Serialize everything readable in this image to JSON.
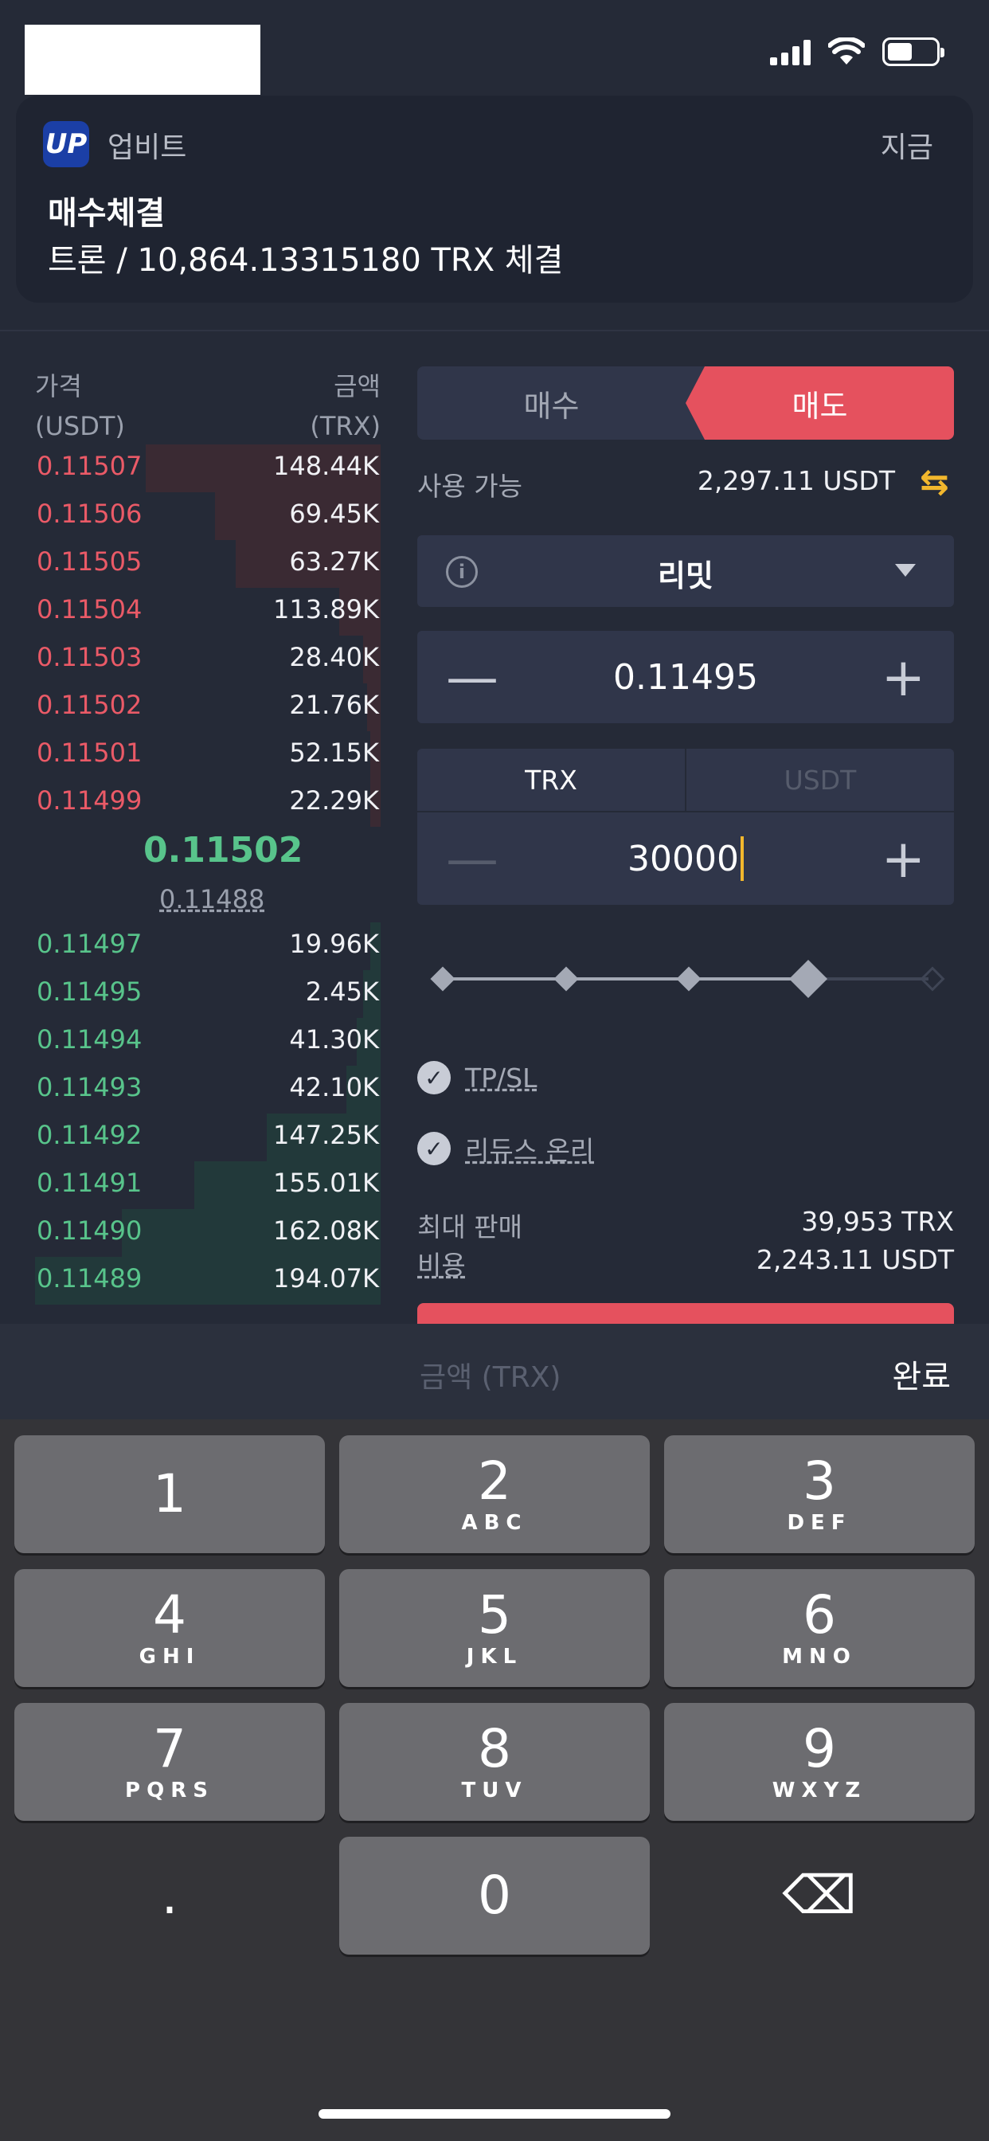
{
  "notification": {
    "app_logo": "UP",
    "app_name": "업비트",
    "time": "지금",
    "title": "매수체결",
    "body": "트론 / 10,864.13315180 TRX 체결"
  },
  "orderbook": {
    "price_header": "가격",
    "price_unit": "(USDT)",
    "amount_header": "금액",
    "amount_unit": "(TRX)",
    "asks": [
      {
        "price": "0.11507",
        "amount": "148.44K",
        "depth": 0.68
      },
      {
        "price": "0.11506",
        "amount": "69.45K",
        "depth": 0.48
      },
      {
        "price": "0.11505",
        "amount": "63.27K",
        "depth": 0.42
      },
      {
        "price": "0.11504",
        "amount": "113.89K",
        "depth": 0.12
      },
      {
        "price": "0.11503",
        "amount": "28.40K",
        "depth": 0.05
      },
      {
        "price": "0.11502",
        "amount": "21.76K",
        "depth": 0.04
      },
      {
        "price": "0.11501",
        "amount": "52.15K",
        "depth": 0.03
      },
      {
        "price": "0.11499",
        "amount": "22.29K",
        "depth": 0.03
      }
    ],
    "last_price": "0.11502",
    "mark_price": "0.11488",
    "bids": [
      {
        "price": "0.11497",
        "amount": "19.96K",
        "depth": 0.03
      },
      {
        "price": "0.11495",
        "amount": "2.45K",
        "depth": 0.05
      },
      {
        "price": "0.11494",
        "amount": "41.30K",
        "depth": 0.07
      },
      {
        "price": "0.11493",
        "amount": "42.10K",
        "depth": 0.1
      },
      {
        "price": "0.11492",
        "amount": "147.25K",
        "depth": 0.33
      },
      {
        "price": "0.11491",
        "amount": "155.01K",
        "depth": 0.54
      },
      {
        "price": "0.11490",
        "amount": "162.08K",
        "depth": 0.75
      },
      {
        "price": "0.11489",
        "amount": "194.07K",
        "depth": 1.0
      }
    ]
  },
  "order_form": {
    "buy_tab": "매수",
    "sell_tab": "매도",
    "available_label": "사용 가능",
    "available_value": "2,297.11 USDT",
    "swap_icon": "⇆",
    "order_type": "리밋",
    "price_value": "0.11495",
    "minus": "—",
    "plus": "+",
    "unit_tab_trx": "TRX",
    "unit_tab_usdt": "USDT",
    "quantity_value": "30000",
    "slider_level": 0.75,
    "tpsl_label": "TP/SL",
    "reduce_only_label": "리듀스 온리",
    "max_sell_label": "최대 판매",
    "max_sell_value": "39,953 TRX",
    "cost_label": "비용",
    "cost_value": "2,243.11 USDT"
  },
  "keyboard_bar": {
    "field_label": "금액 (TRX)",
    "done": "완료"
  },
  "keypad": {
    "keys": [
      {
        "num": "1",
        "sub": ""
      },
      {
        "num": "2",
        "sub": "ABC"
      },
      {
        "num": "3",
        "sub": "DEF"
      },
      {
        "num": "4",
        "sub": "GHI"
      },
      {
        "num": "5",
        "sub": "JKL"
      },
      {
        "num": "6",
        "sub": "MNO"
      },
      {
        "num": "7",
        "sub": "PQRS"
      },
      {
        "num": "8",
        "sub": "TUV"
      },
      {
        "num": "9",
        "sub": "WXYZ"
      },
      {
        "num": ".",
        "sub": ""
      },
      {
        "num": "0",
        "sub": ""
      },
      {
        "num": "⌫",
        "sub": ""
      }
    ]
  }
}
